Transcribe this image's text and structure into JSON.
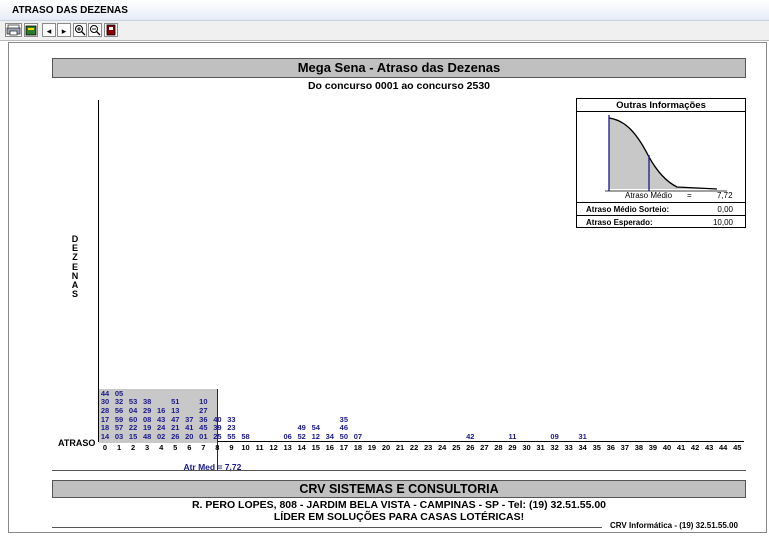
{
  "window": {
    "title": "ATRASO DAS DEZENAS"
  },
  "toolbar": {
    "icons": [
      "print-icon",
      "export-icon",
      "prev-page-icon",
      "next-page-icon",
      "zoom-in-icon",
      "zoom-out-icon",
      "exit-icon"
    ]
  },
  "report": {
    "title": "Mega Sena - Atraso das Dezenas",
    "subtitle": "Do concurso 0001 ao concurso 2530",
    "vertical_label": "DEZENAS",
    "x_axis_label": "ATRASO",
    "avg_label": "Atr Med = 7,72"
  },
  "info_box": {
    "title": "Outras Informações",
    "curve_label": "Atraso Médio",
    "curve_eq": "=",
    "curve_value": "7,72",
    "rows": [
      {
        "label": "Atraso Médio Sorteio:",
        "value": "0,00"
      },
      {
        "label": "Atraso Esperado:",
        "value": "10,00"
      }
    ]
  },
  "footer": {
    "company": "CRV SISTEMAS E CONSULTORIA",
    "address": "R. PERO LOPES, 808 - JARDIM BELA VISTA - CAMPINAS - SP - Tel: (19) 32.51.55.00",
    "slogan": "LÍDER EM SOLUÇÕES PARA CASAS LOTÉRICAS!",
    "credit": "CRV Informática - (19) 32.51.55.00"
  },
  "colors": {
    "avg_line": "#1a1a8c",
    "shade": "#c8c8c8",
    "band": "#c0c0c0"
  },
  "chart_data": {
    "type": "table",
    "x_label": "ATRASO",
    "y_label": "DEZENAS",
    "ticks": [
      "0",
      "1",
      "2",
      "3",
      "4",
      "5",
      "6",
      "7",
      "8",
      "9",
      "10",
      "11",
      "12",
      "13",
      "14",
      "15",
      "16",
      "17",
      "18",
      "19",
      "20",
      "21",
      "22",
      "23",
      "24",
      "25",
      "26",
      "27",
      "28",
      "29",
      "30",
      "31",
      "32",
      "33",
      "34",
      "35",
      "36",
      "37",
      "38",
      "39",
      "40",
      "41",
      "42",
      "43",
      "44",
      "45"
    ],
    "columns": [
      {
        "atraso": 0,
        "dezenas": [
          "14",
          "18",
          "17",
          "28",
          "30",
          "44"
        ]
      },
      {
        "atraso": 1,
        "dezenas": [
          "03",
          "57",
          "59",
          "56",
          "32",
          "05"
        ]
      },
      {
        "atraso": 2,
        "dezenas": [
          "15",
          "22",
          "60",
          "04",
          "53"
        ]
      },
      {
        "atraso": 3,
        "dezenas": [
          "48",
          "19",
          "08",
          "29",
          "38"
        ]
      },
      {
        "atraso": 4,
        "dezenas": [
          "02",
          "24",
          "43",
          "16"
        ]
      },
      {
        "atraso": 5,
        "dezenas": [
          "26",
          "21",
          "47",
          "13",
          "51"
        ]
      },
      {
        "atraso": 6,
        "dezenas": [
          "20",
          "41",
          "37"
        ]
      },
      {
        "atraso": 7,
        "dezenas": [
          "01",
          "45",
          "36",
          "27",
          "10"
        ]
      },
      {
        "atraso": 8,
        "dezenas": [
          "25",
          "39",
          "40"
        ]
      },
      {
        "atraso": 9,
        "dezenas": [
          "55",
          "23",
          "33"
        ]
      },
      {
        "atraso": 10,
        "dezenas": [
          "58"
        ]
      },
      {
        "atraso": 13,
        "dezenas": [
          "06"
        ]
      },
      {
        "atraso": 14,
        "dezenas": [
          "52",
          "49"
        ]
      },
      {
        "atraso": 15,
        "dezenas": [
          "12",
          "54"
        ]
      },
      {
        "atraso": 16,
        "dezenas": [
          "34"
        ]
      },
      {
        "atraso": 17,
        "dezenas": [
          "50",
          "46",
          "35"
        ]
      },
      {
        "atraso": 18,
        "dezenas": [
          "07"
        ]
      },
      {
        "atraso": 26,
        "dezenas": [
          "42"
        ]
      },
      {
        "atraso": 29,
        "dezenas": [
          "11"
        ]
      },
      {
        "atraso": 32,
        "dezenas": [
          "09"
        ]
      },
      {
        "atraso": 34,
        "dezenas": [
          "31"
        ]
      }
    ],
    "avg_atraso": 7.72,
    "shaded_range": [
      0,
      7.72
    ]
  }
}
